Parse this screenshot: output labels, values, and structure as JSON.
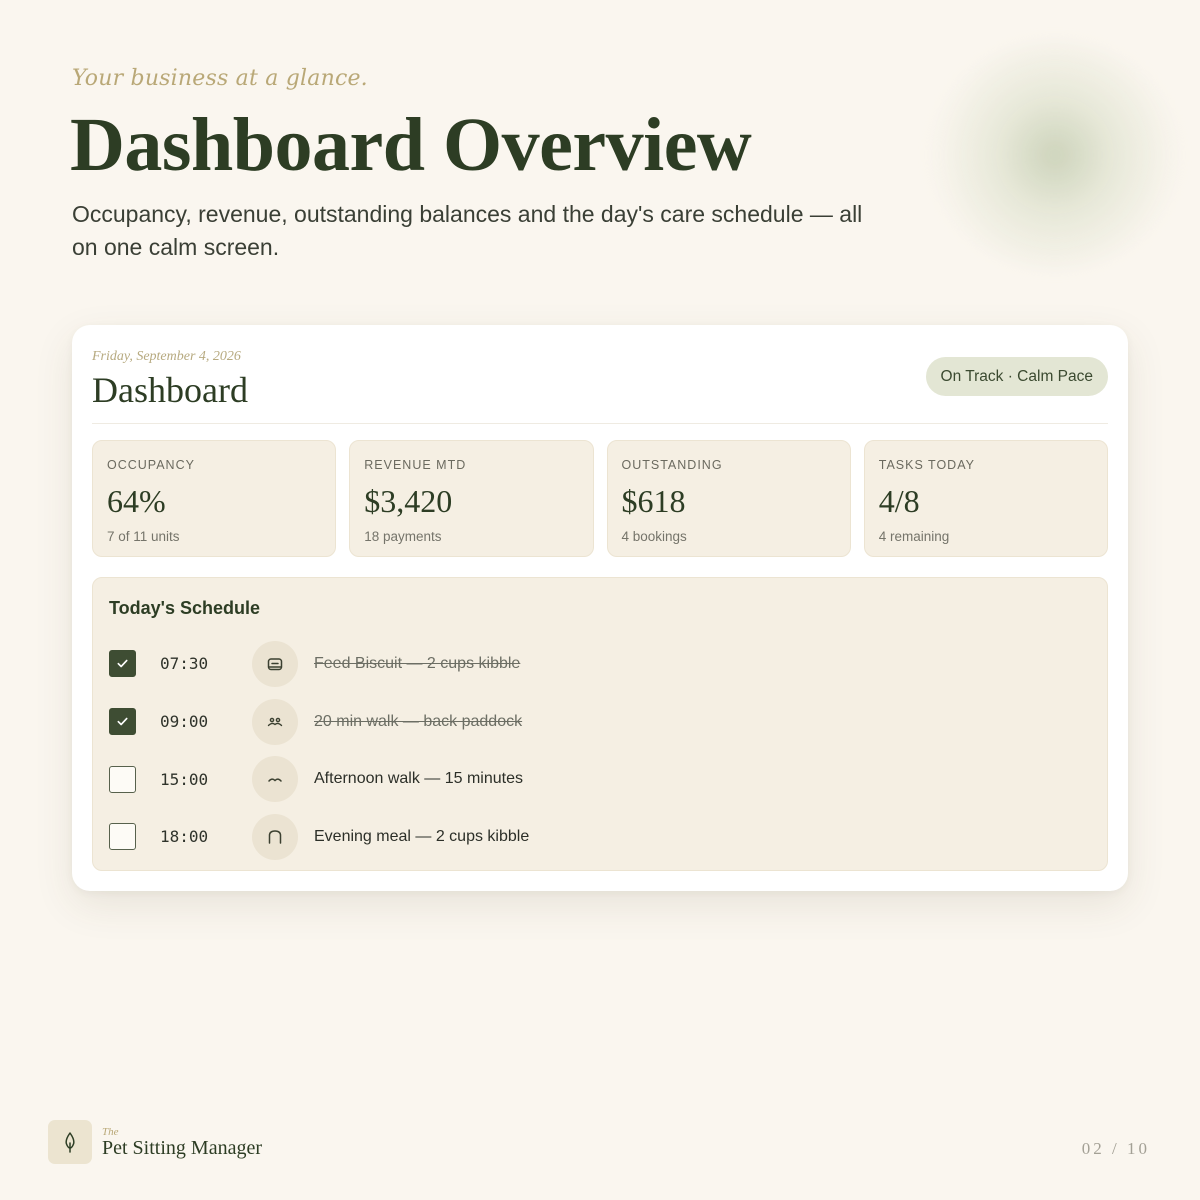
{
  "hero": {
    "eyebrow": "Your business at a glance.",
    "title": "Dashboard Overview",
    "subtitle": "Occupancy, revenue, outstanding balances and the day's care schedule — all on one calm screen."
  },
  "card": {
    "date": "Friday, September 4, 2026",
    "title": "Dashboard",
    "status_pill": "On Track · Calm Pace"
  },
  "stats": [
    {
      "label": "OCCUPANCY",
      "value": "64%",
      "sub": "7 of 11 units"
    },
    {
      "label": "REVENUE MTD",
      "value": "$3,420",
      "sub": "18 payments"
    },
    {
      "label": "OUTSTANDING",
      "value": "$618",
      "sub": "4 bookings"
    },
    {
      "label": "TASKS TODAY",
      "value": "4/8",
      "sub": "4 remaining"
    }
  ],
  "schedule": {
    "title": "Today's Schedule",
    "items": [
      {
        "time": "07:30",
        "task": "Feed Biscuit — 2 cups kibble",
        "done": true,
        "icon": "bowl-icon"
      },
      {
        "time": "09:00",
        "task": "20 min walk — back paddock",
        "done": true,
        "icon": "paw-icon"
      },
      {
        "time": "15:00",
        "task": "Afternoon walk — 15 minutes",
        "done": false,
        "icon": "walk-icon"
      },
      {
        "time": "18:00",
        "task": "Evening meal — 2 cups kibble",
        "done": false,
        "icon": "meal-icon"
      }
    ]
  },
  "footer": {
    "brand_small": "The",
    "brand_name": "Pet Sitting Manager",
    "page": "02 / 10"
  },
  "colors": {
    "background": "#faf6ef",
    "accent_dark": "#3e4d33",
    "card_fill": "#f5efe3",
    "pill": "#e3e6d4"
  }
}
